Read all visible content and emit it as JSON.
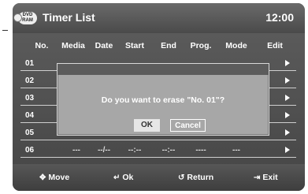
{
  "header": {
    "badge_top": "DVD",
    "badge_bottom": "RAM",
    "title": "Timer List",
    "clock": "12:00"
  },
  "columns": [
    "No.",
    "Media",
    "Date",
    "Start",
    "End",
    "Prog.",
    "Mode",
    "Edit"
  ],
  "rows": [
    {
      "no": "01"
    },
    {
      "no": "02"
    },
    {
      "no": "03"
    },
    {
      "no": "04"
    },
    {
      "no": "05"
    },
    {
      "no": "06",
      "media": "---",
      "date": "--/--",
      "start": "--:--",
      "end": "--:--",
      "prog": "----",
      "mode": "---"
    }
  ],
  "dialog": {
    "message": "Do you want to erase \"No. 01\"?",
    "ok_label": "OK",
    "cancel_label": "Cancel"
  },
  "footer": {
    "move": {
      "icon": "dpad-icon",
      "label": "Move"
    },
    "ok": {
      "icon": "enter-icon",
      "label": "Ok"
    },
    "return": {
      "icon": "return-icon",
      "label": "Return"
    },
    "exit": {
      "icon": "exit-icon",
      "label": "Exit"
    }
  }
}
